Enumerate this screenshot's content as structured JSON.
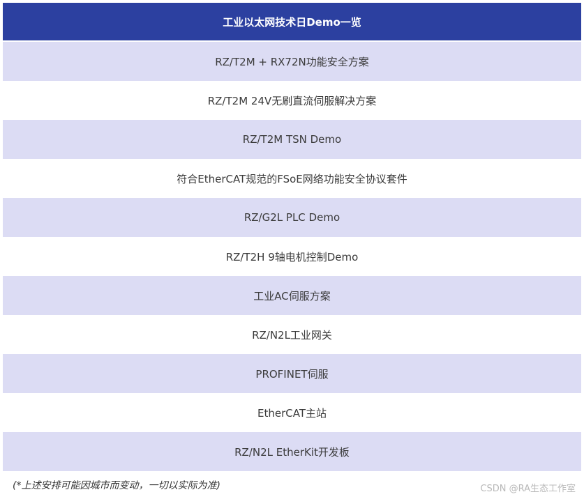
{
  "table": {
    "header": "工业以太网技术日Demo一览",
    "rows": [
      "RZ/T2M + RX72N功能安全方案",
      "RZ/T2M 24V无刷直流伺服解决方案",
      "RZ/T2M TSN Demo",
      "符合EtherCAT规范的FSoE网络功能安全协议套件",
      "RZ/G2L PLC Demo",
      "RZ/T2H 9轴电机控制Demo",
      "工业AC伺服方案",
      "RZ/N2L工业网关",
      "PROFINET伺服",
      "EtherCAT主站",
      "RZ/N2L EtherKit开发板"
    ]
  },
  "note": "(*上述安排可能因城市而变动，一切以实际为准)",
  "watermark": "CSDN @RA生态工作室",
  "colors": {
    "header_bg": "#2c40a0",
    "row_shaded": "#dcdcf4",
    "row_plain": "#ffffff"
  }
}
